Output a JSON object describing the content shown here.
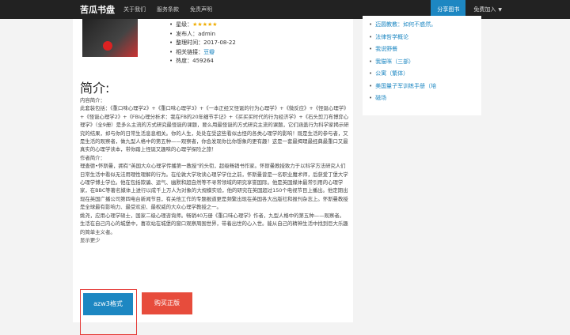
{
  "navbar": {
    "brand": "苦瓜书盘",
    "links": [
      "关于我们",
      "服务条款",
      "免责声明"
    ],
    "share": "分享图书",
    "join": "免费加入"
  },
  "book": {
    "meta": [
      {
        "label": "星级：",
        "value": "★★★★★",
        "type": "stars"
      },
      {
        "label": "发布人：",
        "value": "admin"
      },
      {
        "label": "整理时间：",
        "value": "2017-08-22"
      },
      {
        "label": "相关链接：",
        "value": "豆瓣",
        "type": "link"
      },
      {
        "label": "热度：",
        "value": "459264"
      }
    ]
  },
  "intro": {
    "title": "简介:",
    "paragraphs": [
      "内容简介：",
      "此套装包括：《重口味心理学2》+《重口味心理学3》+《一本正经又怪诞的行为心理学》+《微反应》+《怪诞心理学》+《怪诞心理学2》+《FBI心理分析术：我在FB的20年细节手记》+《买买买时代的行为经济学》+《石头剪刀布博弈心理学》（全9册）是多么主流的方式研究最怪诞的课题，要么用最怪诞的方式研究主流的课题，它们涵盖行为科学家揭示研究的结果，却与你的日常生活息息相关。你的人生，处处在受这些看似古怪的各类心理学的影响！既是生活的参与者，又是生活的观察者，做九型人格中的第五种——观察者，你会发现你比你想象的更有趣！这是一套最揭理最经典最重口又最真实的心理学读本，带你踏上怪诞又趣味的心理学探险之旅！",
      "作者简介：",
      "理查德•怀斯曼，拥有\"英国大众心理学传播第一教授\"的头衔，超级畅销书作家。怀斯曼教授致力于以科学方法研究人们日常生活中看似无法用理性理解的行为。在伦敦大学攻读心理学学位之前，怀斯曼曾是一名职业魔术师，后获爱丁堡大学心理学博士学位。他在包括欺骗、运气、幽默和超自然等不寻常领域的研究享誉国际。他是英国媒体最常引用的心理学家，在BBC等著名媒体上进行以成千上万人为对象的大规模实验，他的研究在英国超过150个电视节目上播出。他定期出现在英国广播公司第四电台新闻节目，有关他工作的专题报道更是频繁出现在英国各大出版社和报刊杂志上。怀斯曼教授是全球最有影响力、最受欢迎、最权威的大众心理学教授之一。",
      "姚尧，应用心理学硕士，国家二级心理咨询师。畅销40万册《重口味心理学》作者，九型人格中的第五种——观察者。生活在自己内心的城堡中，喜欢站在城堡的窗口观察周围世界，带着出世的心入世。能从自己的精神生活中找到巨大乐趣的简单主义者。",
      "显示更少"
    ]
  },
  "actions": {
    "primary": "azw3格式",
    "buy": "购买正版"
  },
  "sidebar": {
    "items": [
      "迈圆教教：如何不惑然。",
      "法律哲学概论",
      "我说野餐",
      "我猫咪（三部）",
      "公寓（繁体）",
      "美国量子军训练手册（培",
      "磁场"
    ]
  }
}
